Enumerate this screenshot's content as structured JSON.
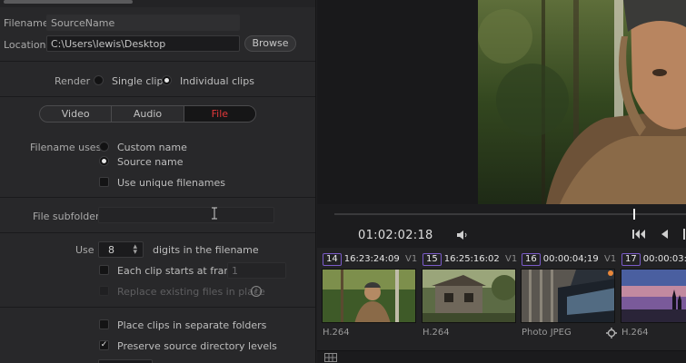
{
  "render_settings": {
    "filename_label": "Filename",
    "filename_value": "SourceName",
    "location_label": "Location",
    "location_value": "C:\\Users\\lewis\\Desktop",
    "browse_label": "Browse",
    "render_label": "Render",
    "render_options": [
      {
        "label": "Single clip",
        "selected": false
      },
      {
        "label": "Individual clips",
        "selected": true
      }
    ],
    "tabs": [
      {
        "label": "Video",
        "active": false
      },
      {
        "label": "Audio",
        "active": false
      },
      {
        "label": "File",
        "active": true
      }
    ],
    "filename_uses_label": "Filename uses",
    "filename_uses_options": [
      {
        "label": "Custom name",
        "selected": false
      },
      {
        "label": "Source name",
        "selected": true
      }
    ],
    "unique_filenames_label": "Use unique filenames",
    "unique_filenames_checked": false,
    "file_subfolder_label": "File subfolder",
    "file_subfolder_value": "",
    "use_label": "Use",
    "digits_value": "8",
    "digits_suffix": "digits in the filename",
    "each_clip_starts_label": "Each clip starts at frame",
    "each_clip_starts_checked": false,
    "start_frame_value": "1",
    "replace_existing_label": "Replace existing files in place",
    "replace_existing_checked": false,
    "separate_folders_label": "Place clips in separate folders",
    "separate_folders_checked": false,
    "preserve_levels_label": "Preserve source directory levels",
    "preserve_levels_checked": true
  },
  "viewer": {
    "timecode": "01:02:02:18",
    "playhead_fraction": 0.85
  },
  "clips": [
    {
      "number": "14",
      "timecode": "16:23:24:09",
      "track": "V1",
      "codec": "H.264"
    },
    {
      "number": "15",
      "timecode": "16:25:16:02",
      "track": "V1",
      "codec": "H.264"
    },
    {
      "number": "16",
      "timecode": "00:00:04;19",
      "track": "V1",
      "codec": "Photo JPEG"
    },
    {
      "number": "17",
      "timecode": "00:00:03:",
      "track": "",
      "codec": "H.264"
    }
  ],
  "colors": {
    "accent_red": "#e4383a",
    "clip_badge_border": "#7a5bc9",
    "panel_bg": "#28282a"
  },
  "icons": {
    "volume": "speaker-icon",
    "skip_back": "skip-to-start-icon",
    "step_back": "step-back-icon",
    "cursor": "text-cursor-icon",
    "info": "info-icon",
    "link": "link-icon"
  }
}
